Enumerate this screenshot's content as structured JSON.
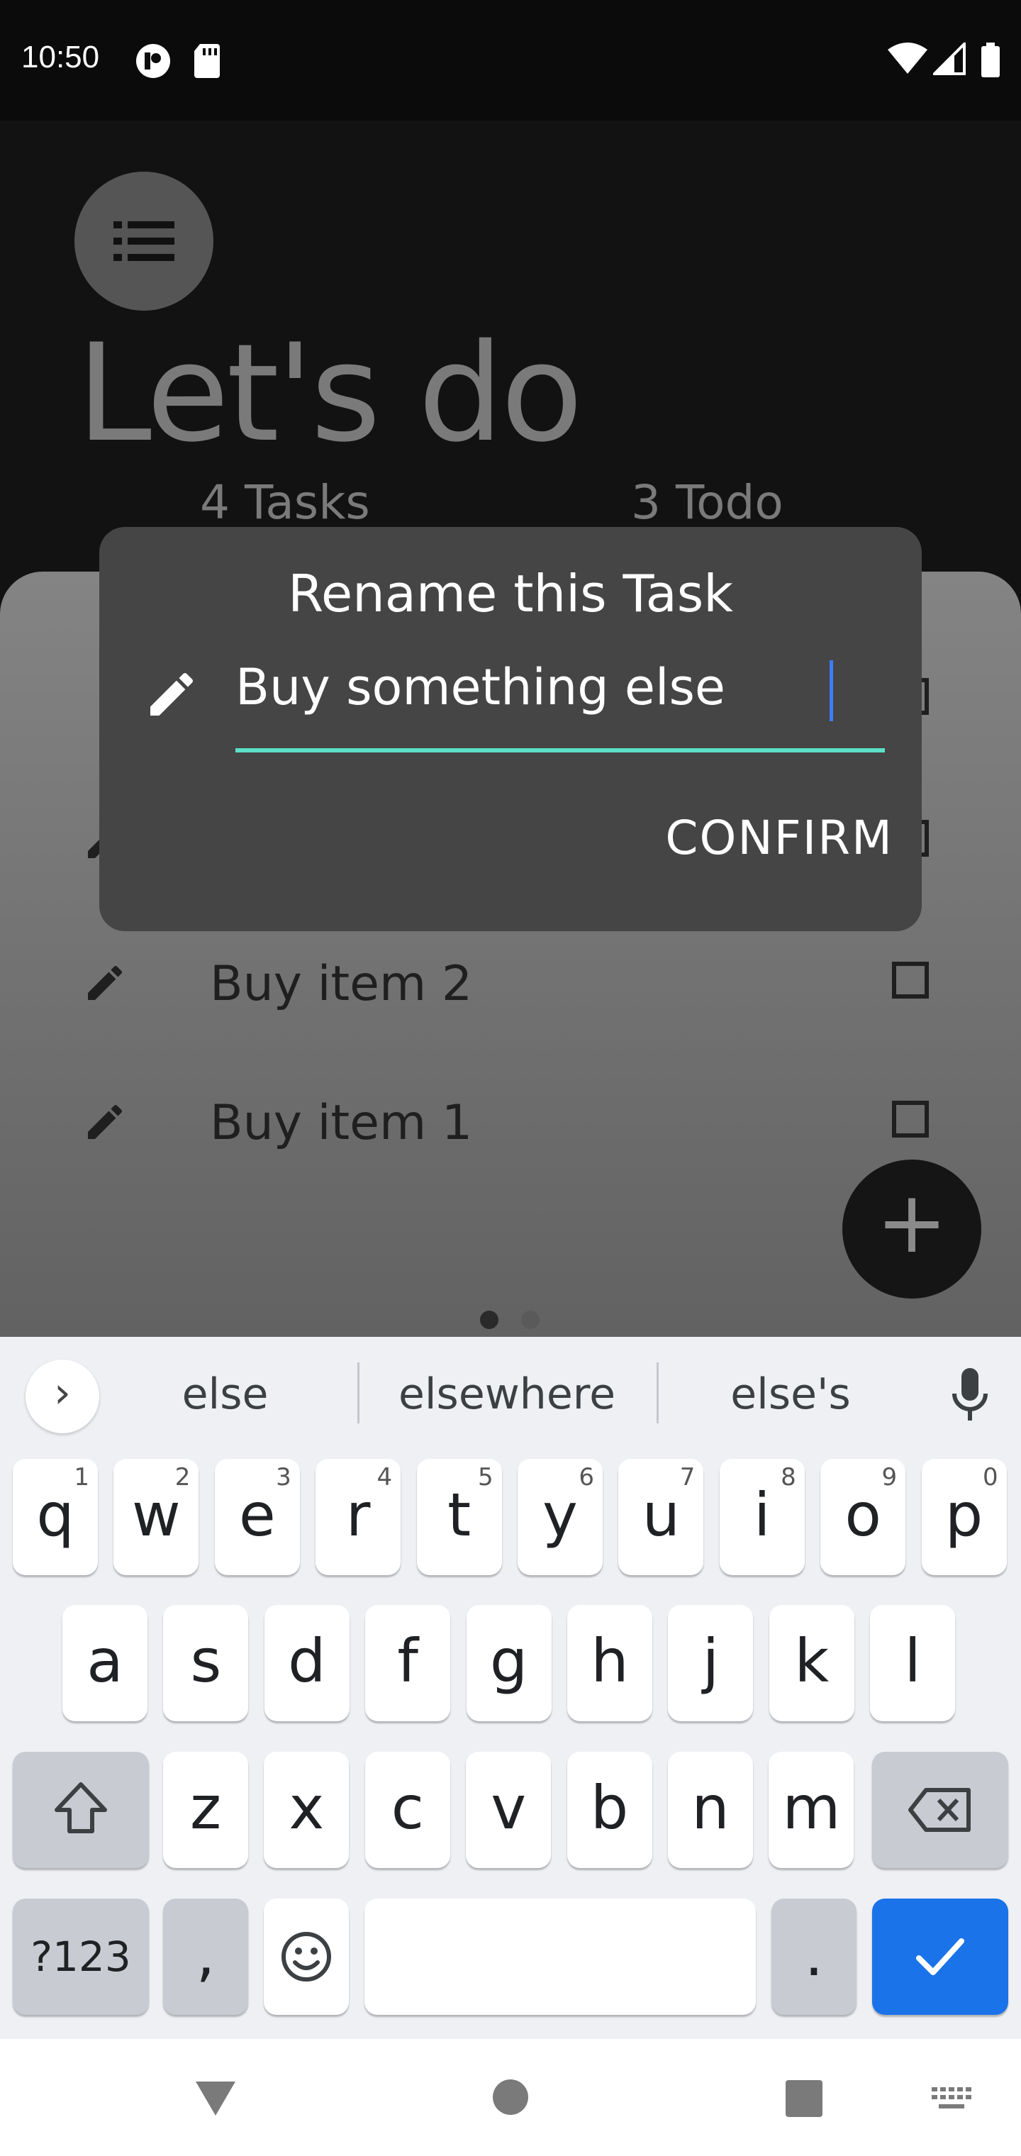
{
  "status_bar": {
    "time": "10:50"
  },
  "app": {
    "title": "Let's do",
    "tasks_count": "4 Tasks",
    "todo_count": "3 Todo",
    "tasks": [
      {
        "label": "Buy item 2"
      },
      {
        "label": "Buy item 1"
      }
    ],
    "fab_symbol": "+"
  },
  "dialog": {
    "title": "Rename this Task",
    "input_value": "Buy something else",
    "confirm_label": "CONFIRM",
    "accent_color": "#5ce0c8"
  },
  "keyboard": {
    "expand_symbol": "›",
    "suggestions": [
      "else",
      "elsewhere",
      "else's"
    ],
    "row1": [
      {
        "ch": "q",
        "hint": "1"
      },
      {
        "ch": "w",
        "hint": "2"
      },
      {
        "ch": "e",
        "hint": "3"
      },
      {
        "ch": "r",
        "hint": "4"
      },
      {
        "ch": "t",
        "hint": "5"
      },
      {
        "ch": "y",
        "hint": "6"
      },
      {
        "ch": "u",
        "hint": "7"
      },
      {
        "ch": "i",
        "hint": "8"
      },
      {
        "ch": "o",
        "hint": "9"
      },
      {
        "ch": "p",
        "hint": "0"
      }
    ],
    "row2": [
      "a",
      "s",
      "d",
      "f",
      "g",
      "h",
      "j",
      "k",
      "l"
    ],
    "row3": [
      "z",
      "x",
      "c",
      "v",
      "b",
      "n",
      "m"
    ],
    "symbols_label": "?123",
    "comma_label": ",",
    "period_label": ".",
    "enter_color": "#1a73e8"
  }
}
